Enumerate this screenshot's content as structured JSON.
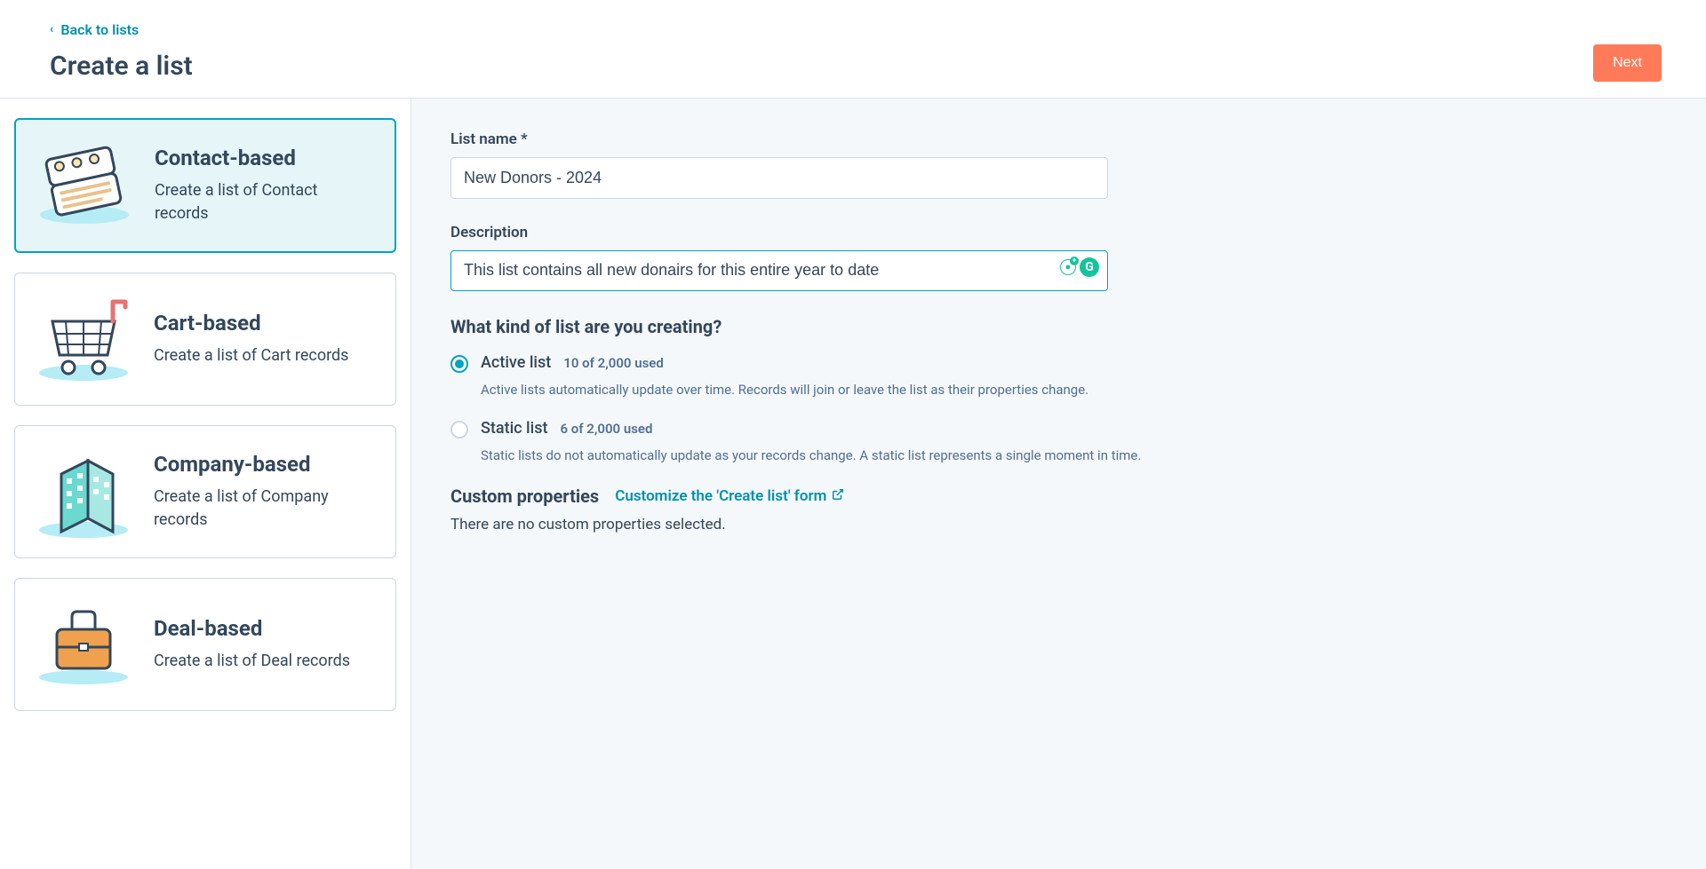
{
  "header": {
    "back_label": "Back to lists",
    "page_title": "Create a list",
    "next_label": "Next"
  },
  "cards": [
    {
      "title": "Contact-based",
      "desc": "Create a list of Contact records",
      "selected": true
    },
    {
      "title": "Cart-based",
      "desc": "Create a list of Cart records",
      "selected": false
    },
    {
      "title": "Company-based",
      "desc": "Create a list of Company records",
      "selected": false
    },
    {
      "title": "Deal-based",
      "desc": "Create a list of Deal records",
      "selected": false
    }
  ],
  "form": {
    "list_name_label": "List name *",
    "list_name_value": "New Donors - 2024",
    "description_label": "Description",
    "description_value": "This list contains all new donairs for this entire year to date",
    "kind_heading": "What kind of list are you creating?",
    "active": {
      "label": "Active list",
      "usage": "10 of 2,000 used",
      "desc": "Active lists automatically update over time. Records will join or leave the list as their properties change."
    },
    "static": {
      "label": "Static list",
      "usage": "6 of 2,000 used",
      "desc": "Static lists do not automatically update as your records change. A static list represents a single moment in time."
    },
    "custom_heading": "Custom properties",
    "customize_link": "Customize the 'Create list' form",
    "custom_none": "There are no custom properties selected."
  }
}
